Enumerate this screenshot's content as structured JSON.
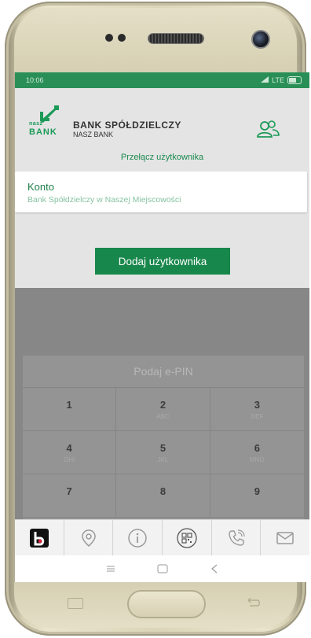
{
  "status": {
    "time": "10:06",
    "network": "LTE"
  },
  "header": {
    "logo_small": "nasz",
    "logo_big": "BANK",
    "bank_name": "BANK SPÓŁDZIELCZY",
    "bank_sub": "NASZ BANK"
  },
  "switch_user_label": "Przełącz użytkownika",
  "account": {
    "title": "Konto",
    "subtitle": "Bank Spółdzielczy w Naszej Miejscowości"
  },
  "add_user_button": "Dodaj użytkownika",
  "pin": {
    "label": "Podaj e-PIN",
    "keys": [
      {
        "num": "1",
        "letters": ""
      },
      {
        "num": "2",
        "letters": "ABC"
      },
      {
        "num": "3",
        "letters": "DEF"
      },
      {
        "num": "4",
        "letters": "GHI"
      },
      {
        "num": "5",
        "letters": "JKL"
      },
      {
        "num": "6",
        "letters": "MNO"
      },
      {
        "num": "7",
        "letters": ""
      },
      {
        "num": "8",
        "letters": ""
      },
      {
        "num": "9",
        "letters": ""
      }
    ]
  },
  "app_bar": [
    "bank-app-icon",
    "location-pin-icon",
    "info-icon",
    "qr-code-icon",
    "phone-icon",
    "mail-icon"
  ],
  "colors": {
    "brand_green": "#18874c",
    "status_bar": "#2a8f57"
  }
}
